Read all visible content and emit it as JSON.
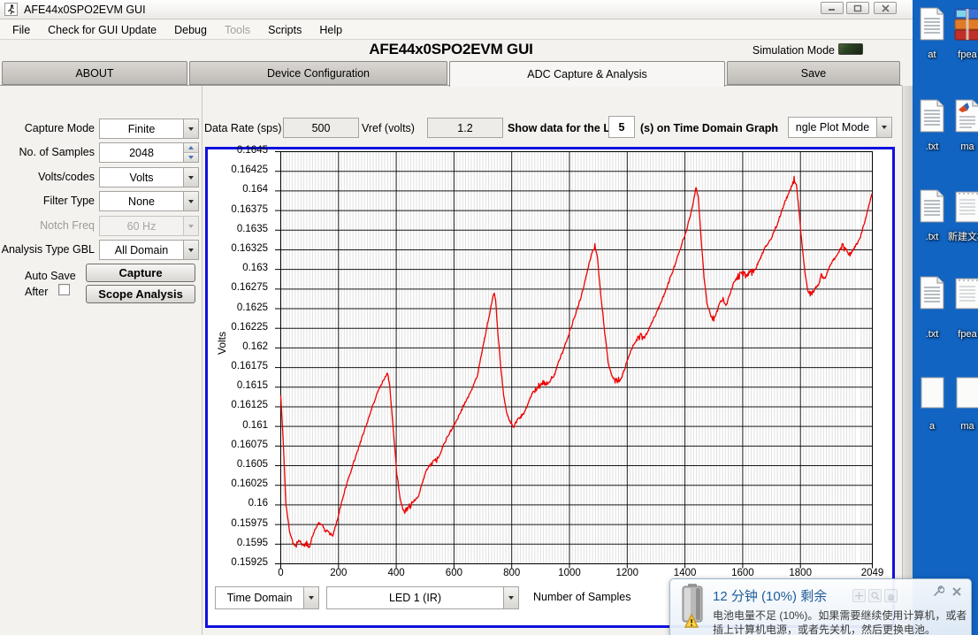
{
  "desktop": {
    "background_color": "#1164C2",
    "icons": [
      {
        "col": 0,
        "row": 0,
        "label": "at",
        "icon": "text-file-icon"
      },
      {
        "col": 1,
        "row": 0,
        "label": "fpea",
        "icon": "winrar-archive-icon"
      },
      {
        "col": 0,
        "row": 1,
        "label": ".txt",
        "icon": "text-file-icon"
      },
      {
        "col": 1,
        "row": 1,
        "label": "ma",
        "icon": "matlab-file-icon"
      },
      {
        "col": 0,
        "row": 2,
        "label": ".txt",
        "icon": "text-file-icon"
      },
      {
        "col": 1,
        "row": 2,
        "label": "新建文档",
        "icon": "notepad-file-icon"
      },
      {
        "col": 0,
        "row": 3,
        "label": ".txt",
        "icon": "text-file-icon"
      },
      {
        "col": 1,
        "row": 3,
        "label": "fpea",
        "icon": "notepad-file-icon"
      },
      {
        "col": 0,
        "row": 4,
        "label": "a",
        "icon": "file-icon"
      },
      {
        "col": 1,
        "row": 4,
        "label": "ma",
        "icon": "file-icon"
      }
    ]
  },
  "window": {
    "titlebar": {
      "title": "AFE44x0SPO2EVM GUI"
    },
    "menu": [
      {
        "label": "File",
        "enabled": true
      },
      {
        "label": "Check for GUI Update",
        "enabled": true
      },
      {
        "label": "Debug",
        "enabled": true
      },
      {
        "label": "Tools",
        "enabled": false
      },
      {
        "label": "Scripts",
        "enabled": true
      },
      {
        "label": "Help",
        "enabled": true
      }
    ],
    "header": {
      "title": "AFE44x0SPO2EVM GUI",
      "simulation_mode_label": "Simulation Mode"
    },
    "tabs": [
      {
        "label": "ABOUT",
        "active": false
      },
      {
        "label": "Device Configuration",
        "active": false
      },
      {
        "label": "ADC Capture & Analysis",
        "active": true
      },
      {
        "label": "Save",
        "active": false
      }
    ],
    "left_panel": {
      "rows": [
        {
          "label": "Capture Mode",
          "control": "dropdown",
          "value": "Finite",
          "enabled": true
        },
        {
          "label": "No. of Samples",
          "control": "spinner",
          "value": "2048",
          "enabled": true
        },
        {
          "label": "Volts/codes",
          "control": "dropdown",
          "value": "Volts",
          "enabled": true
        },
        {
          "label": "Filter Type",
          "control": "dropdown",
          "value": "None",
          "enabled": true
        },
        {
          "label": "Notch Freq",
          "control": "dropdown",
          "value": "60 Hz",
          "enabled": false
        },
        {
          "label": "Analysis Type GBL",
          "control": "dropdown",
          "value": "All Domain",
          "enabled": true
        }
      ],
      "auto_save_line1": "Auto Save",
      "auto_save_line2": "After",
      "auto_save_checked": false,
      "capture_button": "Capture",
      "scope_button": "Scope Analysis"
    },
    "top_controls": {
      "data_rate_label": "Data Rate (sps)",
      "data_rate_value": "500",
      "vref_label": "Vref (volts)",
      "vref_value": "1.2",
      "show_last_label": "Show data for the LAST",
      "show_last_value": "5",
      "show_last_suffix": "(s) on Time Domain Graph",
      "plot_mode_value": "ngle Plot Mode"
    },
    "graph_controls": {
      "domain_value": "Time Domain",
      "signal_value": "LED 1 (IR)"
    }
  },
  "chart_data": {
    "type": "line",
    "title": "",
    "xlabel": "Number of Samples",
    "ylabel": "Volts",
    "xlim": [
      0,
      2049
    ],
    "ylim": [
      0.15925,
      0.1645
    ],
    "x_ticks": [
      "0",
      "200",
      "400",
      "600",
      "800",
      "1000",
      "1200",
      "1400",
      "1600",
      "1800",
      "2049"
    ],
    "x_tick_values": [
      0,
      200,
      400,
      600,
      800,
      1000,
      1200,
      1400,
      1600,
      1800,
      2049
    ],
    "y_tick_step": 0.00025,
    "y_ticks": [
      "0.1645",
      "0.16425",
      "0.164",
      "0.16375",
      "0.1635",
      "0.16325",
      "0.163",
      "0.16275",
      "0.1625",
      "0.16225",
      "0.162",
      "0.16175",
      "0.1615",
      "0.16125",
      "0.161",
      "0.16075",
      "0.1605",
      "0.16025",
      "0.16",
      "0.15975",
      "0.1595",
      "0.15925"
    ],
    "grid": {
      "minor_x_step": 10,
      "major_x_step": 200,
      "minor_color": "#DBDBDB",
      "major_color": "#000000"
    },
    "line_color": "#EE0000",
    "noise": {
      "flat_amp": 4e-05,
      "slope_amp": 1.6e-05
    },
    "series": [
      {
        "name": "LED 1 (IR)",
        "anchors": [
          [
            0,
            0.1614
          ],
          [
            8,
            0.16085
          ],
          [
            18,
            0.16
          ],
          [
            30,
            0.15968
          ],
          [
            42,
            0.15952
          ],
          [
            55,
            0.1595
          ],
          [
            65,
            0.15956
          ],
          [
            75,
            0.15948
          ],
          [
            88,
            0.15952
          ],
          [
            98,
            0.15944
          ],
          [
            108,
            0.15958
          ],
          [
            118,
            0.15968
          ],
          [
            128,
            0.15975
          ],
          [
            140,
            0.15976
          ],
          [
            152,
            0.1597
          ],
          [
            163,
            0.15968
          ],
          [
            172,
            0.15962
          ],
          [
            180,
            0.1596
          ],
          [
            195,
            0.1598
          ],
          [
            215,
            0.1601
          ],
          [
            240,
            0.1604
          ],
          [
            265,
            0.16068
          ],
          [
            290,
            0.16095
          ],
          [
            315,
            0.16122
          ],
          [
            340,
            0.16148
          ],
          [
            358,
            0.1616
          ],
          [
            370,
            0.16168
          ],
          [
            378,
            0.1615
          ],
          [
            390,
            0.16095
          ],
          [
            402,
            0.1604
          ],
          [
            415,
            0.16005
          ],
          [
            428,
            0.1599
          ],
          [
            440,
            0.15995
          ],
          [
            452,
            0.16
          ],
          [
            465,
            0.16005
          ],
          [
            478,
            0.16013
          ],
          [
            492,
            0.1603
          ],
          [
            505,
            0.16045
          ],
          [
            518,
            0.16052
          ],
          [
            532,
            0.16055
          ],
          [
            545,
            0.16058
          ],
          [
            562,
            0.16075
          ],
          [
            585,
            0.16092
          ],
          [
            610,
            0.16108
          ],
          [
            635,
            0.16128
          ],
          [
            660,
            0.16145
          ],
          [
            680,
            0.16163
          ],
          [
            700,
            0.162
          ],
          [
            720,
            0.16238
          ],
          [
            738,
            0.16272
          ],
          [
            744,
            0.16262
          ],
          [
            752,
            0.1622
          ],
          [
            762,
            0.16175
          ],
          [
            772,
            0.1614
          ],
          [
            782,
            0.16118
          ],
          [
            795,
            0.16105
          ],
          [
            808,
            0.16102
          ],
          [
            820,
            0.16108
          ],
          [
            832,
            0.16112
          ],
          [
            845,
            0.16118
          ],
          [
            858,
            0.1613
          ],
          [
            870,
            0.16142
          ],
          [
            882,
            0.16148
          ],
          [
            895,
            0.16152
          ],
          [
            908,
            0.16155
          ],
          [
            920,
            0.16152
          ],
          [
            932,
            0.16158
          ],
          [
            945,
            0.16162
          ],
          [
            960,
            0.1618
          ],
          [
            980,
            0.16198
          ],
          [
            1000,
            0.1622
          ],
          [
            1020,
            0.16242
          ],
          [
            1040,
            0.16265
          ],
          [
            1060,
            0.16295
          ],
          [
            1075,
            0.16318
          ],
          [
            1088,
            0.1633
          ],
          [
            1096,
            0.16318
          ],
          [
            1105,
            0.1628
          ],
          [
            1115,
            0.16245
          ],
          [
            1125,
            0.1621
          ],
          [
            1135,
            0.1618
          ],
          [
            1145,
            0.16165
          ],
          [
            1158,
            0.16158
          ],
          [
            1170,
            0.1616
          ],
          [
            1182,
            0.16163
          ],
          [
            1195,
            0.16178
          ],
          [
            1208,
            0.16192
          ],
          [
            1220,
            0.16202
          ],
          [
            1232,
            0.1621
          ],
          [
            1245,
            0.16215
          ],
          [
            1258,
            0.16212
          ],
          [
            1270,
            0.1622
          ],
          [
            1285,
            0.16232
          ],
          [
            1305,
            0.16248
          ],
          [
            1330,
            0.1627
          ],
          [
            1355,
            0.16295
          ],
          [
            1380,
            0.16322
          ],
          [
            1405,
            0.1635
          ],
          [
            1425,
            0.16378
          ],
          [
            1438,
            0.16405
          ],
          [
            1446,
            0.16392
          ],
          [
            1456,
            0.1634
          ],
          [
            1466,
            0.1629
          ],
          [
            1476,
            0.16258
          ],
          [
            1488,
            0.16242
          ],
          [
            1500,
            0.16236
          ],
          [
            1512,
            0.16248
          ],
          [
            1522,
            0.16258
          ],
          [
            1532,
            0.16262
          ],
          [
            1542,
            0.16252
          ],
          [
            1555,
            0.16268
          ],
          [
            1568,
            0.16282
          ],
          [
            1582,
            0.1629
          ],
          [
            1598,
            0.16295
          ],
          [
            1612,
            0.16292
          ],
          [
            1626,
            0.16295
          ],
          [
            1640,
            0.16298
          ],
          [
            1658,
            0.16312
          ],
          [
            1678,
            0.16328
          ],
          [
            1700,
            0.1634
          ],
          [
            1722,
            0.1636
          ],
          [
            1745,
            0.16385
          ],
          [
            1765,
            0.16402
          ],
          [
            1778,
            0.16415
          ],
          [
            1786,
            0.16408
          ],
          [
            1796,
            0.1637
          ],
          [
            1806,
            0.1633
          ],
          [
            1816,
            0.16295
          ],
          [
            1826,
            0.16272
          ],
          [
            1838,
            0.16268
          ],
          [
            1850,
            0.16275
          ],
          [
            1862,
            0.1628
          ],
          [
            1872,
            0.16292
          ],
          [
            1882,
            0.16285
          ],
          [
            1895,
            0.16298
          ],
          [
            1908,
            0.16308
          ],
          [
            1920,
            0.16315
          ],
          [
            1932,
            0.16322
          ],
          [
            1945,
            0.1633
          ],
          [
            1958,
            0.16325
          ],
          [
            1970,
            0.16318
          ],
          [
            1982,
            0.16325
          ],
          [
            1995,
            0.16332
          ],
          [
            2008,
            0.16342
          ],
          [
            2022,
            0.1636
          ],
          [
            2036,
            0.1638
          ],
          [
            2049,
            0.16398
          ]
        ]
      }
    ]
  },
  "notification": {
    "title": "12 分钟 (10%) 剩余",
    "body_line1": "电池电量不足 (10%)。如果需要继续使用计算机，或者",
    "body_line2": "插上计算机电源，或者先关机，然后更换电池。"
  },
  "colors": {
    "chart_border": "#1010DF",
    "line": "#EE0000",
    "desktop": "#1164C2",
    "led": "#24421E"
  }
}
